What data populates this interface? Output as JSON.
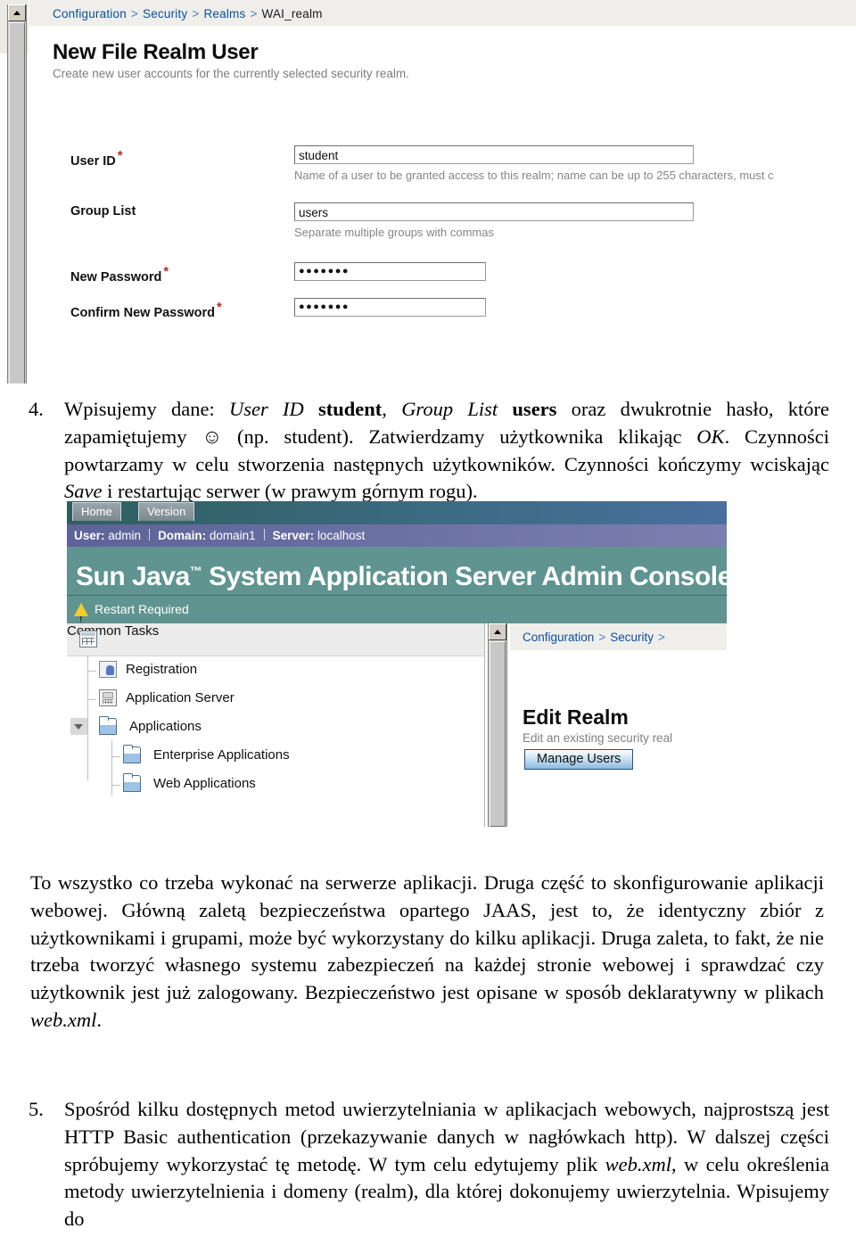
{
  "screenshot1": {
    "breadcrumb": {
      "items": [
        "Configuration",
        "Security",
        "Realms",
        "WAI_realm"
      ],
      "separator": ">"
    },
    "page_title": "New File Realm User",
    "page_subtitle": "Create new user accounts for the currently selected security realm.",
    "fields": [
      {
        "label": "User ID",
        "required": true,
        "value": "student",
        "help": "Name of a user to be granted access to this realm; name can be up to 255 characters, must c"
      },
      {
        "label": "Group List",
        "required": false,
        "value": "users",
        "help": "Separate multiple groups with commas"
      },
      {
        "label": "New Password",
        "required": true,
        "value": "●●●●●●●",
        "help": ""
      },
      {
        "label": "Confirm New Password",
        "required": true,
        "value": "●●●●●●●",
        "help": ""
      }
    ],
    "required_marker": "*"
  },
  "item4": {
    "number": "4.",
    "line_a": "Wpisujemy dane: ",
    "em_user_id": "User ID",
    "bold_student": "student",
    "comma": ", ",
    "em_group_list": "Group List",
    "bold_users": "users",
    "line_b": " oraz dwukrotnie hasło, które zapamiętujemy ☺ (np. student). Zatwierdzamy użytkownika klikając ",
    "em_ok": "OK",
    "line_c": ". Czynności powtarzamy w celu stworzenia następnych użytkowników. Czynności kończymy wciskając ",
    "em_save": "Save",
    "line_d": " i restartując serwer (w prawym górnym rogu)."
  },
  "screenshot2": {
    "tabs": [
      {
        "label": "Home"
      },
      {
        "label": "Version"
      }
    ],
    "identity": {
      "user_label": "User:",
      "user_value": "admin",
      "domain_label": "Domain:",
      "domain_value": "domain1",
      "server_label": "Server:",
      "server_value": "localhost"
    },
    "brand_title_a": "Sun Java",
    "brand_tm": "™",
    "brand_title_b": " System Application Server Admin Console",
    "alert": "Restart Required",
    "tree": {
      "header_item": "Common Tasks",
      "items": [
        {
          "label": "Registration",
          "icon": "registration-icon",
          "indent": 1
        },
        {
          "label": "Application Server",
          "icon": "server-icon",
          "indent": 1
        },
        {
          "label": "Applications",
          "icon": "folder-icon",
          "indent": 1,
          "expanded": true
        },
        {
          "label": "Enterprise Applications",
          "icon": "folder-icon",
          "indent": 2
        },
        {
          "label": "Web Applications",
          "icon": "folder-icon",
          "indent": 2
        }
      ]
    },
    "content": {
      "breadcrumb_items": [
        "Configuration",
        "Security"
      ],
      "breadcrumb_separator": ">",
      "title": "Edit Realm",
      "subtitle": "Edit an existing security real",
      "button": "Manage Users"
    },
    "colors": {
      "brand_bar": "#5f9490",
      "identity_bar": "#5d6398",
      "tab_bar": "#2f5f5d",
      "breadcrumb_link": "#0a4f9e",
      "warning": "#f5cc2a",
      "button_accent": "#8cb8dd"
    }
  },
  "paragraph1": {
    "l1": "To wszystko co trzeba wykonać na serwerze aplikacji. Druga część to skonfigurowanie aplikacji webowej. Główną zaletą bezpieczeństwa opartego JAAS, jest to, że identyczny zbiór z użytkownikami i grupami, może być wykorzystany do kilku aplikacji. Druga zaleta, to fakt, że nie trzeba tworzyć własnego systemu zabezpieczeń na każdej stronie webowej i sprawdzać czy użytkownik jest już zalogowany. Bezpieczeństwo jest opisane w sposób deklaratywny w plikach ",
    "em_webxml": "web.xml",
    "l2": "."
  },
  "item5": {
    "number": "5.",
    "l1": "Spośród kilku dostępnych metod uwierzytelniania w aplikacjach webowych, najprostszą jest HTTP Basic authentication (przekazywanie danych w nagłówkach http). W dalszej części spróbujemy wykorzystać tę metodę. W tym celu edytujemy plik ",
    "em_webxml": "web.xml",
    "l2": ", w celu określenia metody uwierzytelnienia i domeny (realm), dla której dokonujemy uwierzytelnia. Wpisujemy do"
  }
}
